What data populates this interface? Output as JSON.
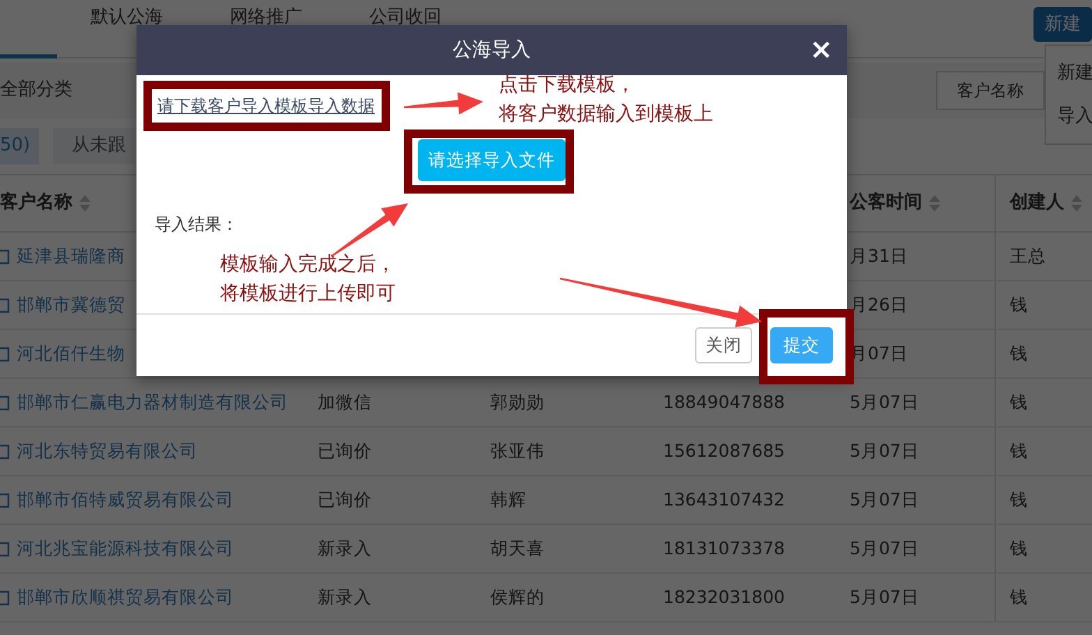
{
  "page_tabs": [
    {
      "selected": true
    },
    {
      "label": "默认公海",
      "selected": false
    },
    {
      "label": "网络推广",
      "selected": false
    },
    {
      "label": "公司收回",
      "selected": false
    }
  ],
  "new_button": {
    "label": "新建"
  },
  "new_menu": {
    "items": [
      "新建",
      "导入"
    ]
  },
  "filters": {
    "category": "全部分类",
    "search_field": "客户名称"
  },
  "quick_filters": [
    {
      "label": "50)",
      "selected": true
    },
    {
      "label": "从未跟",
      "selected": false
    }
  ],
  "table": {
    "columns": [
      {
        "label": "客户名称"
      },
      {
        "label": "公客时间"
      },
      {
        "label": "创建人"
      }
    ],
    "rows": [
      {
        "name": "延津县瑞隆商",
        "date": "月31日",
        "creator": "王总"
      },
      {
        "name": "邯郸市冀德贸",
        "date": "月26日",
        "creator": "钱"
      },
      {
        "name": "河北佰仟生物",
        "date": "月07日",
        "creator": "钱"
      },
      {
        "name": "邯郸市仁赢电力器材制造有限公司",
        "status": "加微信",
        "contact": "郭勋勋",
        "phone": "18849047888",
        "date": "5月07日",
        "creator": "钱"
      },
      {
        "name": "河北东特贸易有限公司",
        "status": "已询价",
        "contact": "张亚伟",
        "phone": "15612087685",
        "date": "5月07日",
        "creator": "钱"
      },
      {
        "name": "邯郸市佰特威贸易有限公司",
        "status": "已询价",
        "contact": "韩辉",
        "phone": "13643107432",
        "date": "5月07日",
        "creator": "钱"
      },
      {
        "name": "河北兆宝能源科技有限公司",
        "status": "新录入",
        "contact": "胡天喜",
        "phone": "18131073378",
        "date": "5月07日",
        "creator": "钱"
      },
      {
        "name": "邯郸市欣顺祺贸易有限公司",
        "status": "新录入",
        "contact": "侯辉的",
        "phone": "18232031800",
        "date": "5月07日",
        "creator": "钱"
      }
    ]
  },
  "modal": {
    "title": "公海导入",
    "close_symbol": "×",
    "template_link": "请下载客户导入模板导入数据",
    "choose_file_button": "请选择导入文件",
    "result_label": "导入结果：",
    "buttons": [
      {
        "label": "关闭",
        "kind": "secondary"
      },
      {
        "label": "提交",
        "kind": "primary"
      }
    ]
  },
  "annotations": [
    {
      "lines": [
        "点击下载模板，",
        "将客户数据输入到模板上"
      ]
    },
    {
      "lines": [
        "模板输入完成之后，",
        "将模板进行上传即可"
      ]
    }
  ]
}
